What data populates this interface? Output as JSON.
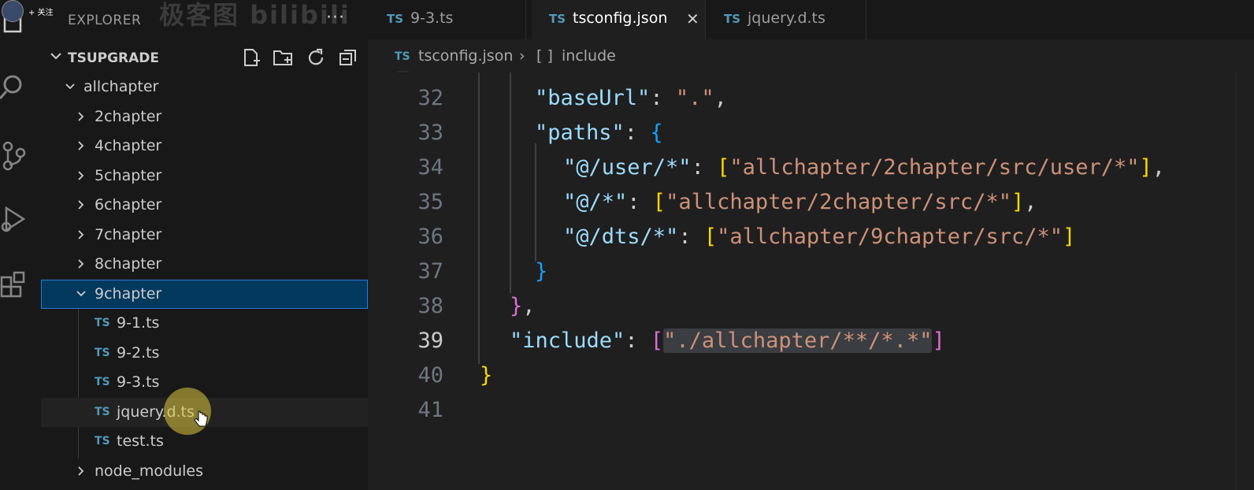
{
  "overlay": {
    "follow_label": "+ 关注",
    "logo_text": "极客图 bilibili"
  },
  "sidebar": {
    "title": "EXPLORER",
    "more_actions": "···",
    "project": "TSUPGRADE",
    "tree": [
      {
        "label": "allchapter",
        "type": "folder",
        "expanded": true
      },
      {
        "label": "2chapter",
        "type": "folder",
        "expanded": false
      },
      {
        "label": "4chapter",
        "type": "folder",
        "expanded": false
      },
      {
        "label": "5chapter",
        "type": "folder",
        "expanded": false
      },
      {
        "label": "6chapter",
        "type": "folder",
        "expanded": false
      },
      {
        "label": "7chapter",
        "type": "folder",
        "expanded": false
      },
      {
        "label": "8chapter",
        "type": "folder",
        "expanded": false
      },
      {
        "label": "9chapter",
        "type": "folder",
        "expanded": true,
        "selected": true
      },
      {
        "label": "9-1.ts",
        "type": "file",
        "icon": "TS"
      },
      {
        "label": "9-2.ts",
        "type": "file",
        "icon": "TS"
      },
      {
        "label": "9-3.ts",
        "type": "file",
        "icon": "TS"
      },
      {
        "label": "jquery.d.ts",
        "type": "file",
        "icon": "TS",
        "hover": true
      },
      {
        "label": "test.ts",
        "type": "file",
        "icon": "TS"
      },
      {
        "label": "node_modules",
        "type": "folder",
        "expanded": false
      }
    ]
  },
  "tabs": [
    {
      "icon": "TS",
      "label": "9-3.ts",
      "active": false
    },
    {
      "icon": "TS",
      "label": "tsconfig.json",
      "active": true,
      "close": "✕"
    },
    {
      "icon": "TS",
      "label": "jquery.d.ts",
      "active": false
    }
  ],
  "breadcrumb": {
    "icon": "TS",
    "file": "tsconfig.json",
    "sep": "›",
    "symbol_icon": "[ ]",
    "symbol": "include"
  },
  "editor": {
    "current_line": 39,
    "lines": [
      {
        "n": "32",
        "tokens": [
          {
            "t": "\"baseUrl\"",
            "c": "k"
          },
          {
            "t": ": ",
            "c": "p"
          },
          {
            "t": "\".\"",
            "c": "s"
          },
          {
            "t": ",",
            "c": "p"
          }
        ]
      },
      {
        "n": "33",
        "tokens": [
          {
            "t": "\"paths\"",
            "c": "k"
          },
          {
            "t": ": ",
            "c": "p"
          },
          {
            "t": "{",
            "c": "b3"
          }
        ]
      },
      {
        "n": "34",
        "tokens": [
          {
            "t": "\"@/user/*\"",
            "c": "k"
          },
          {
            "t": ": ",
            "c": "p"
          },
          {
            "t": "[",
            "c": "b1"
          },
          {
            "t": "\"allchapter/2chapter/src/user/*\"",
            "c": "s"
          },
          {
            "t": "]",
            "c": "b1"
          },
          {
            "t": ",",
            "c": "p"
          }
        ]
      },
      {
        "n": "35",
        "tokens": [
          {
            "t": "\"@/*\"",
            "c": "k"
          },
          {
            "t": ": ",
            "c": "p"
          },
          {
            "t": "[",
            "c": "b1"
          },
          {
            "t": "\"allchapter/2chapter/src/*\"",
            "c": "s"
          },
          {
            "t": "]",
            "c": "b1"
          },
          {
            "t": ",",
            "c": "p"
          }
        ]
      },
      {
        "n": "36",
        "tokens": [
          {
            "t": "\"@/dts/*\"",
            "c": "k"
          },
          {
            "t": ": ",
            "c": "p"
          },
          {
            "t": "[",
            "c": "b1"
          },
          {
            "t": "\"allchapter/9chapter/src/*\"",
            "c": "s"
          },
          {
            "t": "]",
            "c": "b1"
          }
        ]
      },
      {
        "n": "37",
        "tokens": [
          {
            "t": "}",
            "c": "b3"
          }
        ]
      },
      {
        "n": "38",
        "tokens": [
          {
            "t": "}",
            "c": "b2"
          },
          {
            "t": ",",
            "c": "p"
          }
        ]
      },
      {
        "n": "39",
        "tokens": [
          {
            "t": "\"include\"",
            "c": "k"
          },
          {
            "t": ": ",
            "c": "p"
          },
          {
            "t": "[",
            "c": "b2"
          },
          {
            "t": "\"./allchapter/**/*.*\"",
            "c": "s",
            "hl": true
          },
          {
            "t": "]",
            "c": "b2"
          }
        ]
      },
      {
        "n": "40",
        "tokens": [
          {
            "t": "}",
            "c": "b1"
          }
        ]
      },
      {
        "n": "41",
        "tokens": []
      }
    ]
  },
  "colors": {
    "accent": "#04395e",
    "ts_icon": "#519aba",
    "string": "#ce9178",
    "key": "#9cdcfe"
  }
}
